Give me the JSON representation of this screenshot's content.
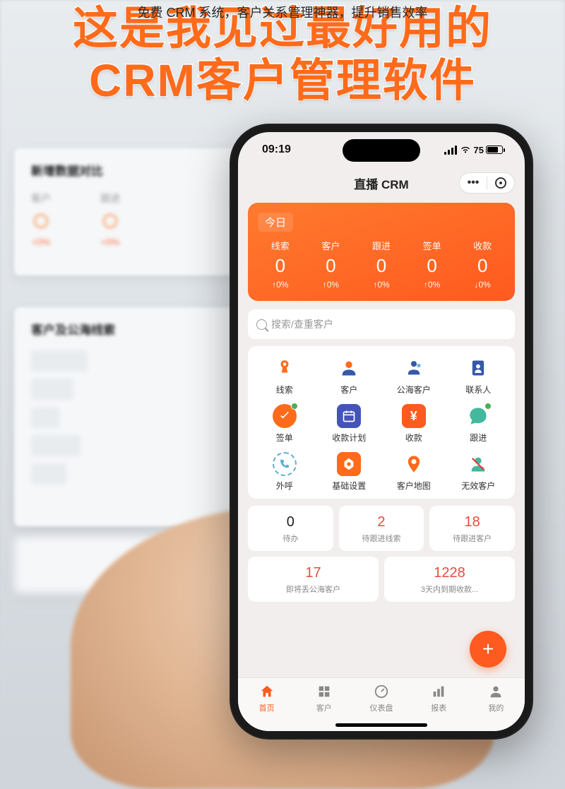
{
  "caption": "免费 CRM 系统，客户关系管理神器，提升销售效率",
  "headline_l1": "这是我见过最好用的",
  "headline_l2": "CRM客户管理软件",
  "desktop": {
    "panel1_title": "新增数据对比",
    "col1_label": "客户",
    "col2_label": "跟进",
    "pct1": "+0%",
    "pct2": "+0%",
    "panel2_title": "客户及公海线索"
  },
  "status": {
    "time": "09:19",
    "battery": "75"
  },
  "app_title": "直播 CRM",
  "dash": {
    "today": "今日",
    "items": [
      {
        "label": "线索",
        "value": "0",
        "pct": "0%",
        "dir": "up"
      },
      {
        "label": "客户",
        "value": "0",
        "pct": "0%",
        "dir": "up"
      },
      {
        "label": "跟进",
        "value": "0",
        "pct": "0%",
        "dir": "up"
      },
      {
        "label": "签单",
        "value": "0",
        "pct": "0%",
        "dir": "up"
      },
      {
        "label": "收款",
        "value": "0",
        "pct": "0%",
        "dir": "down"
      }
    ]
  },
  "search_placeholder": "搜索/查重客户",
  "grid": [
    {
      "id": "lead",
      "label": "线索"
    },
    {
      "id": "customer",
      "label": "客户"
    },
    {
      "id": "public-customer",
      "label": "公海客户"
    },
    {
      "id": "contact",
      "label": "联系人"
    },
    {
      "id": "sign",
      "label": "签单"
    },
    {
      "id": "payplan",
      "label": "收款计划"
    },
    {
      "id": "payment",
      "label": "收款"
    },
    {
      "id": "followup",
      "label": "跟进"
    },
    {
      "id": "outcall",
      "label": "外呼"
    },
    {
      "id": "settings",
      "label": "基础设置"
    },
    {
      "id": "cust-map",
      "label": "客户地图"
    },
    {
      "id": "invalid",
      "label": "无效客户"
    }
  ],
  "stats_r1": [
    {
      "num": "0",
      "label": "待办",
      "red": false
    },
    {
      "num": "2",
      "label": "待跟进线索",
      "red": true
    },
    {
      "num": "18",
      "label": "待跟进客户",
      "red": true
    }
  ],
  "stats_r2": [
    {
      "num": "17",
      "label": "即将丢公海客户",
      "red": true
    },
    {
      "num": "1228",
      "label": "3天内到期收款...",
      "red": true
    }
  ],
  "tabs": [
    {
      "id": "home",
      "label": "首页",
      "active": true
    },
    {
      "id": "customers",
      "label": "客户",
      "active": false
    },
    {
      "id": "dashboard",
      "label": "仪表盘",
      "active": false
    },
    {
      "id": "reports",
      "label": "报表",
      "active": false
    },
    {
      "id": "mine",
      "label": "我的",
      "active": false
    }
  ]
}
